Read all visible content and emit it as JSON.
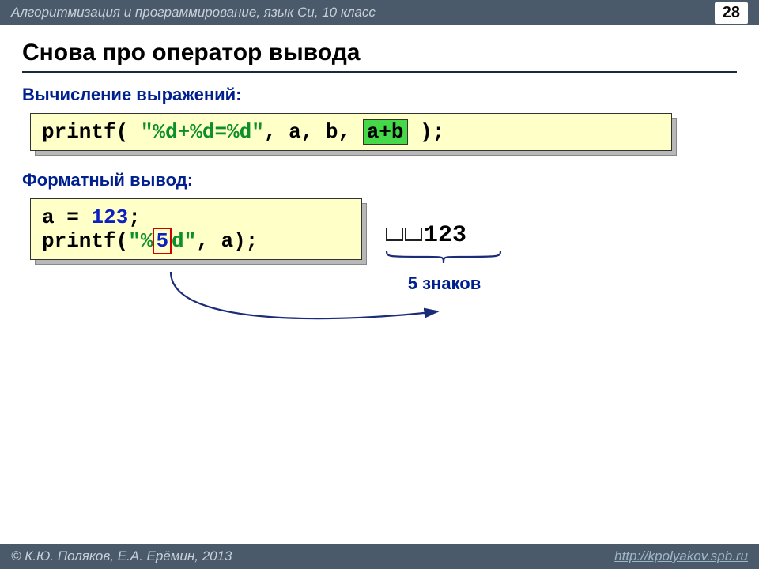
{
  "header": {
    "course": "Алгоритмизация и программирование, язык Си, 10 класс",
    "page": "28"
  },
  "title": "Снова про оператор вывода",
  "section1": {
    "heading": "Вычисление выражений:",
    "code": {
      "p1": "printf( ",
      "fmt": "\"%d+%d=%d\"",
      "p2": ", a, b, ",
      "hl": "a+b",
      "p3": " );"
    }
  },
  "section2": {
    "heading": "Форматный вывод:",
    "code": {
      "l1a": "a = ",
      "l1num": "123",
      "l1b": ";",
      "l2a": "printf(",
      "l2fmt1": "\"%",
      "l2w": "5",
      "l2fmt2": "d\"",
      "l2b": ", a);"
    },
    "output": "123",
    "annotation": "5 знаков"
  },
  "footer": {
    "copyright": "© К.Ю. Поляков, Е.А. Ерёмин, 2013",
    "url": "http://kpolyakov.spb.ru"
  }
}
